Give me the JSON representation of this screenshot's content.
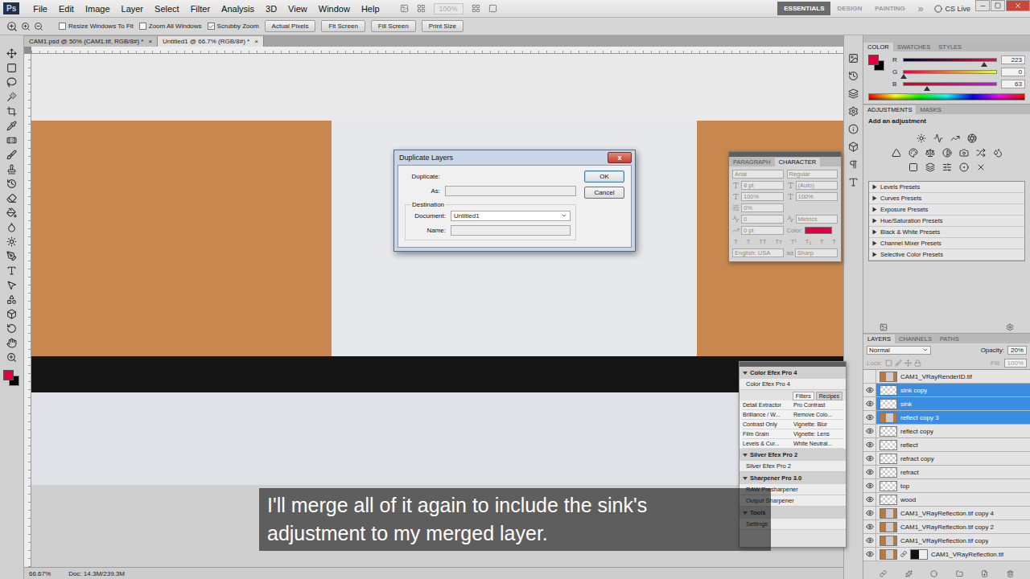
{
  "menubar": {
    "logo": "Ps",
    "menus": [
      "File",
      "Edit",
      "Image",
      "Layer",
      "Select",
      "Filter",
      "Analysis",
      "3D",
      "View",
      "Window",
      "Help"
    ],
    "zoom": "100%",
    "workspaces": [
      {
        "label": "ESSENTIALS",
        "selected": true
      },
      {
        "label": "DESIGN",
        "selected": false
      },
      {
        "label": "PAINTING",
        "selected": false
      }
    ],
    "more": "»",
    "cs_live": "CS Live"
  },
  "options_bar": {
    "checkboxes": [
      {
        "label": "Resize Windows To Fit",
        "checked": false
      },
      {
        "label": "Zoom All Windows",
        "checked": false
      },
      {
        "label": "Scrubby Zoom",
        "checked": true
      }
    ],
    "buttons": [
      "Actual Pixels",
      "Fit Screen",
      "Fill Screen",
      "Print Size"
    ]
  },
  "doc_tabs": [
    {
      "label": "CAM1.psd @ 50% (CAM1.tif, RGB/8#) *",
      "close": "×",
      "selected": false
    },
    {
      "label": "Untitled1 @ 66.7% (RGB/8#) *",
      "close": "×",
      "selected": true
    }
  ],
  "status_bar": {
    "zoom": "66.67%",
    "doc": "Doc: 14.3M/239.3M"
  },
  "color_panel": {
    "tabs": [
      {
        "label": "COLOR",
        "selected": true
      },
      {
        "label": "SWATCHES",
        "selected": false
      },
      {
        "label": "STYLES",
        "selected": false
      }
    ],
    "channels": [
      {
        "name": "R",
        "value": "223",
        "level": 0.87
      },
      {
        "name": "G",
        "value": "0",
        "level": 0
      },
      {
        "name": "B",
        "value": "63",
        "level": 0.25
      }
    ]
  },
  "adjustments_panel": {
    "tabs": [
      {
        "label": "ADJUSTMENTS",
        "selected": true
      },
      {
        "label": "MASKS",
        "selected": false
      }
    ],
    "heading": "Add an adjustment",
    "presets": [
      {
        "label": "Levels Presets",
        "expanded": false
      },
      {
        "label": "Curves Presets",
        "expanded": false
      },
      {
        "label": "Exposure Presets",
        "expanded": false
      },
      {
        "label": "Hue/Saturation Presets",
        "expanded": false
      },
      {
        "label": "Black & White Presets",
        "expanded": false
      },
      {
        "label": "Channel Mixer Presets",
        "expanded": false
      },
      {
        "label": "Selective Color Presets",
        "expanded": false
      }
    ]
  },
  "layers_panel": {
    "tabs": [
      {
        "label": "LAYERS",
        "selected": true
      },
      {
        "label": "CHANNELS",
        "selected": false
      },
      {
        "label": "PATHS",
        "selected": false
      }
    ],
    "blend_mode": "Normal",
    "opacity_label": "Opacity:",
    "opacity": "20%",
    "lock_label": "Lock:",
    "fill_label": "Fill:",
    "fill": "100%",
    "layers": [
      {
        "name": "CAM1_VRayRenderID.tif",
        "visible": false,
        "selected": false,
        "kind": "image",
        "mask": false
      },
      {
        "name": "sink copy",
        "visible": true,
        "selected": true,
        "kind": "checker",
        "mask": false
      },
      {
        "name": "sink",
        "visible": true,
        "selected": true,
        "kind": "checker",
        "mask": false
      },
      {
        "name": "reflect copy 3",
        "visible": true,
        "selected": true,
        "kind": "image",
        "mask": false
      },
      {
        "name": "reflect copy",
        "visible": true,
        "selected": false,
        "kind": "checker",
        "mask": false
      },
      {
        "name": "reflect",
        "visible": true,
        "selected": false,
        "kind": "checker",
        "mask": false
      },
      {
        "name": "refract copy",
        "visible": true,
        "selected": false,
        "kind": "checker",
        "mask": false
      },
      {
        "name": "refract",
        "visible": true,
        "selected": false,
        "kind": "checker",
        "mask": false
      },
      {
        "name": "top",
        "visible": true,
        "selected": false,
        "kind": "checker",
        "mask": false
      },
      {
        "name": "wood",
        "visible": true,
        "selected": false,
        "kind": "checker",
        "mask": false
      },
      {
        "name": "CAM1_VRayReflection.tif copy 4",
        "visible": true,
        "selected": false,
        "kind": "image",
        "mask": false
      },
      {
        "name": "CAM1_VRayReflection.tif copy 2",
        "visible": true,
        "selected": false,
        "kind": "image",
        "mask": false
      },
      {
        "name": "CAM1_VRayReflection.tif copy",
        "visible": true,
        "selected": false,
        "kind": "image",
        "mask": false
      },
      {
        "name": "CAM1_VRayReflection.tif",
        "visible": true,
        "selected": false,
        "kind": "image",
        "mask": true
      }
    ]
  },
  "character_panel": {
    "tabs": [
      {
        "label": "PARAGRAPH",
        "selected": false
      },
      {
        "label": "CHARACTER",
        "selected": true
      }
    ],
    "disabled": true,
    "font": "Arial",
    "style": "Regular",
    "size": "8 pt",
    "leading": "(Auto)",
    "vertical_scale": "100%",
    "horizontal_scale": "100%",
    "tsume": "0%",
    "tracking": "0",
    "kerning": "Metrics",
    "baseline": "0 pt",
    "color_label": "Color:",
    "style_buttons": [
      "T",
      "T",
      "TT",
      "Tт",
      "T¹",
      "T₁",
      "T",
      "T"
    ],
    "language": "English: USA",
    "antialias_label": "aa",
    "antialias": "Sharp"
  },
  "efex_panel": {
    "title": "Color Efex Pro 4",
    "launcher": "Color Efex Pro 4",
    "tabs": [
      {
        "label": "Filters",
        "selected": true
      },
      {
        "label": "Recipes",
        "selected": false
      }
    ],
    "filters": [
      "Detail Extractor",
      "Pro Contrast",
      "Brilliance / W...",
      "Remove Colo...",
      "Contrast Only",
      "Vignette: Blur",
      "Film Grain",
      "Vignette: Lens",
      "Levels & Cur...",
      "White Neutral..."
    ],
    "sections": [
      {
        "title": "Silver Efex Pro 2",
        "items": [
          "Silver Efex Pro 2"
        ]
      },
      {
        "title": "Sharpener Pro 3.0",
        "items": [
          "RAW Presharpener",
          "Output Sharpener"
        ]
      },
      {
        "title": "Tools",
        "items": []
      }
    ],
    "footer": "Settings"
  },
  "dialog": {
    "title": "Duplicate Layers",
    "close": "x",
    "duplicate_label": "Duplicate:",
    "as_label": "As:",
    "destination_label": "Destination",
    "document_label": "Document:",
    "document_value": "Untitled1",
    "name_label": "Name:",
    "buttons": [
      {
        "label": "OK",
        "default": true
      },
      {
        "label": "Cancel",
        "default": false
      }
    ]
  },
  "subtitle": {
    "lines": [
      "I'll merge all of it again to include the sink's",
      "adjustment to my merged layer."
    ]
  }
}
